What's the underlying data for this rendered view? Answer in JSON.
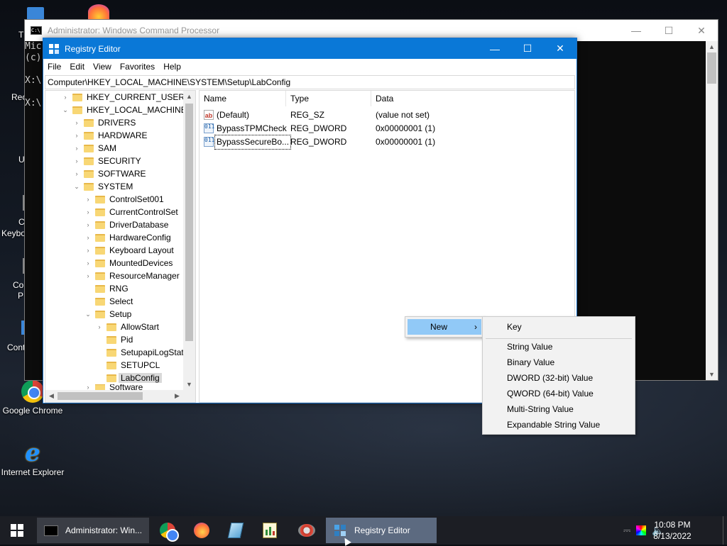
{
  "desktop": {
    "icons": [
      {
        "label": "Google Chrome"
      },
      {
        "label": "Internet Explorer"
      }
    ],
    "partial_labels": [
      "T",
      "Rec",
      "U",
      "C",
      "Keybo",
      "Co",
      "P",
      "Cont"
    ]
  },
  "cmd_window": {
    "title": "Administrator: Windows Command Processor",
    "lines": [
      "Mic",
      "(c)",
      "",
      "X:\\",
      "",
      "X:\\"
    ]
  },
  "regedit": {
    "title": "Registry Editor",
    "menu": [
      "File",
      "Edit",
      "View",
      "Favorites",
      "Help"
    ],
    "address": "Computer\\HKEY_LOCAL_MACHINE\\SYSTEM\\Setup\\LabConfig",
    "tree": [
      {
        "label": "HKEY_CURRENT_USER",
        "expander": "›"
      },
      {
        "label": "HKEY_LOCAL_MACHINE",
        "expander": "⌄"
      },
      {
        "label": "DRIVERS",
        "expander": "›"
      },
      {
        "label": "HARDWARE",
        "expander": "›"
      },
      {
        "label": "SAM",
        "expander": "›"
      },
      {
        "label": "SECURITY",
        "expander": "›"
      },
      {
        "label": "SOFTWARE",
        "expander": "›"
      },
      {
        "label": "SYSTEM",
        "expander": "⌄"
      },
      {
        "label": "ControlSet001",
        "expander": "›"
      },
      {
        "label": "CurrentControlSet",
        "expander": "›"
      },
      {
        "label": "DriverDatabase",
        "expander": "›"
      },
      {
        "label": "HardwareConfig",
        "expander": "›"
      },
      {
        "label": "Keyboard Layout",
        "expander": "›"
      },
      {
        "label": "MountedDevices",
        "expander": "›"
      },
      {
        "label": "ResourceManager",
        "expander": "›"
      },
      {
        "label": "RNG",
        "expander": ""
      },
      {
        "label": "Select",
        "expander": ""
      },
      {
        "label": "Setup",
        "expander": "⌄"
      },
      {
        "label": "AllowStart",
        "expander": "›"
      },
      {
        "label": "Pid",
        "expander": ""
      },
      {
        "label": "SetupapiLogStatu",
        "expander": ""
      },
      {
        "label": "SETUPCL",
        "expander": ""
      },
      {
        "label": "LabConfig",
        "expander": ""
      },
      {
        "label": "Software",
        "expander": "›"
      }
    ],
    "columns": [
      "Name",
      "Type",
      "Data"
    ],
    "values": [
      {
        "icon": "ab",
        "name": "(Default)",
        "type": "REG_SZ",
        "data": "(value not set)"
      },
      {
        "icon": "011",
        "name": "BypassTPMCheck",
        "type": "REG_DWORD",
        "data": "0x00000001 (1)"
      },
      {
        "icon": "011",
        "name": "BypassSecureBo...",
        "type": "REG_DWORD",
        "data": "0x00000001 (1)"
      }
    ]
  },
  "context_menu": {
    "new_label": "New",
    "submenu": [
      "Key",
      "String Value",
      "Binary Value",
      "DWORD (32-bit) Value",
      "QWORD (64-bit) Value",
      "Multi-String Value",
      "Expandable String Value"
    ]
  },
  "taskbar": {
    "tasks": [
      {
        "label": "Administrator: Win..."
      },
      {
        "label": "Registry Editor"
      }
    ],
    "time": "10:08 PM",
    "date": "8/13/2022"
  }
}
